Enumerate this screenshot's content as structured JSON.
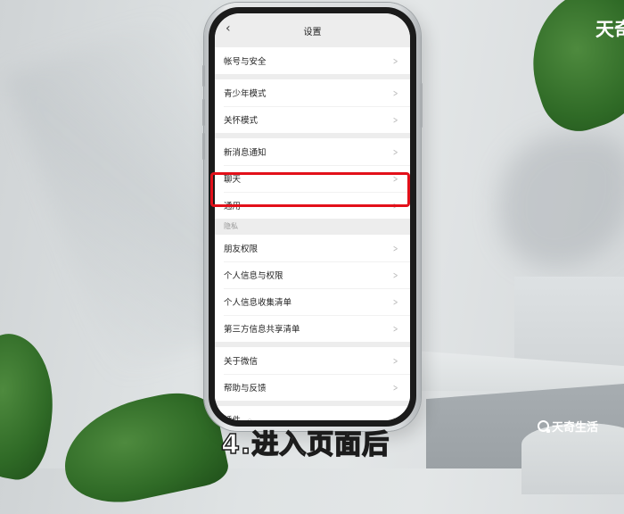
{
  "nav": {
    "title": "设置",
    "back_icon": "chevron-left-icon"
  },
  "groups": [
    {
      "items": [
        {
          "label": "帐号与安全"
        }
      ]
    },
    {
      "items": [
        {
          "label": "青少年模式"
        },
        {
          "label": "关怀模式"
        }
      ]
    },
    {
      "items": [
        {
          "label": "新消息通知"
        },
        {
          "label": "聊天"
        },
        {
          "label": "通用",
          "highlighted": true
        }
      ]
    },
    {
      "section_label": "隐私",
      "items": [
        {
          "label": "朋友权限"
        },
        {
          "label": "个人信息与权限"
        },
        {
          "label": "个人信息收集清单"
        },
        {
          "label": "第三方信息共享清单"
        }
      ]
    },
    {
      "items": [
        {
          "label": "关于微信"
        },
        {
          "label": "帮助与反馈"
        }
      ]
    },
    {
      "items": [
        {
          "label": "插件"
        }
      ]
    }
  ],
  "highlight_color": "#e3101a",
  "caption": "4.进入页面后",
  "watermark": {
    "top_text": "天奇",
    "bottom_text": "天奇生活",
    "logo_icon": "search-q-logo-icon"
  }
}
